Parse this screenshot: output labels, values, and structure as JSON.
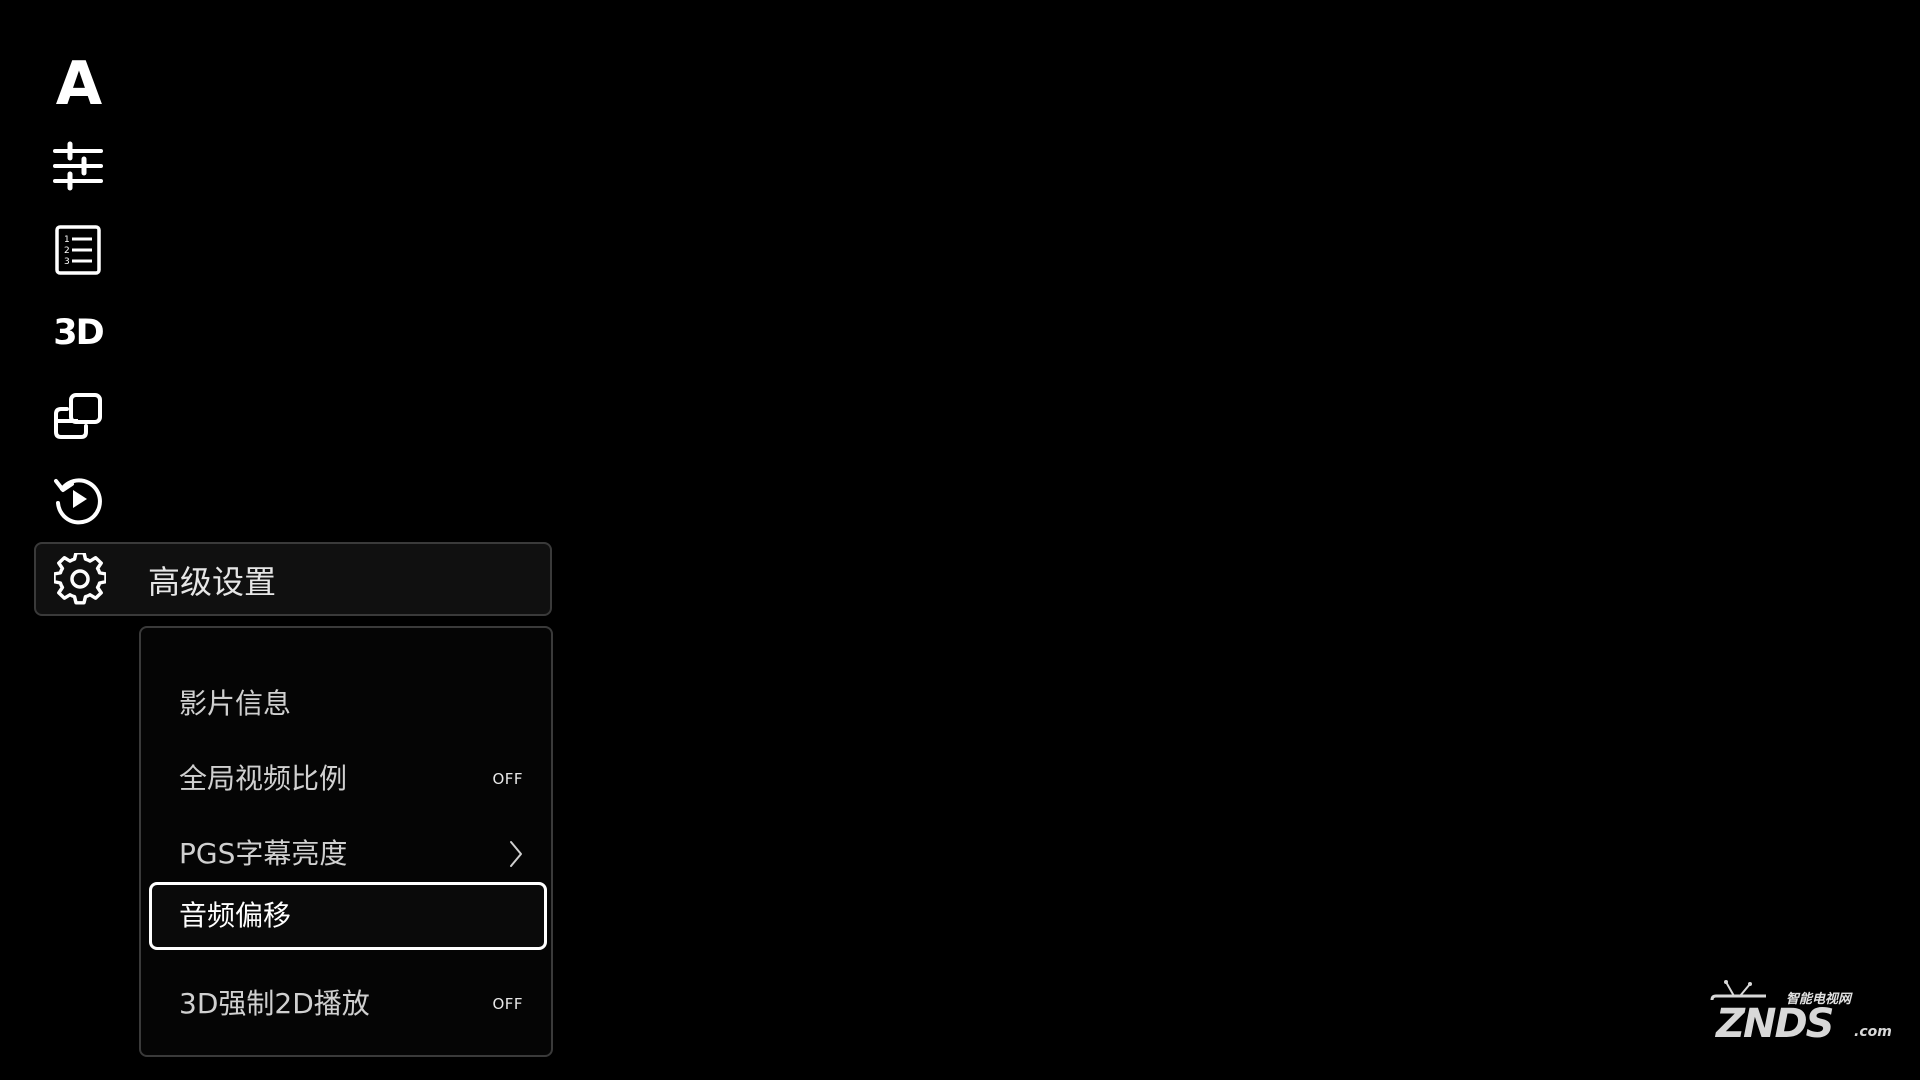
{
  "rail": {
    "icons": [
      {
        "name": "subtitle-font-icon",
        "glyph": "A"
      },
      {
        "name": "sliders-icon"
      },
      {
        "name": "numbered-list-icon"
      },
      {
        "name": "3d-icon",
        "glyph": "3D"
      },
      {
        "name": "picture-in-picture-icon"
      },
      {
        "name": "replay-icon"
      },
      {
        "name": "gear-icon"
      }
    ]
  },
  "menu": {
    "selected_label": "高级设置"
  },
  "submenu": {
    "items": [
      {
        "label": "影片信息",
        "value": ""
      },
      {
        "label": "全局视频比例",
        "value": "OFF"
      },
      {
        "label": "PGS字幕亮度",
        "value": "",
        "has_chevron": true
      },
      {
        "label": "音频偏移",
        "value": "",
        "focused": true
      },
      {
        "label": "3D强制2D播放",
        "value": "OFF"
      }
    ]
  },
  "watermark": {
    "top_text": "智能电视网",
    "brand": "ZNDS",
    "suffix": ".com"
  },
  "colors": {
    "background": "#000000",
    "text": "#ffffff",
    "panel_border": "#3a3a3a",
    "focus_border": "#ffffff"
  }
}
